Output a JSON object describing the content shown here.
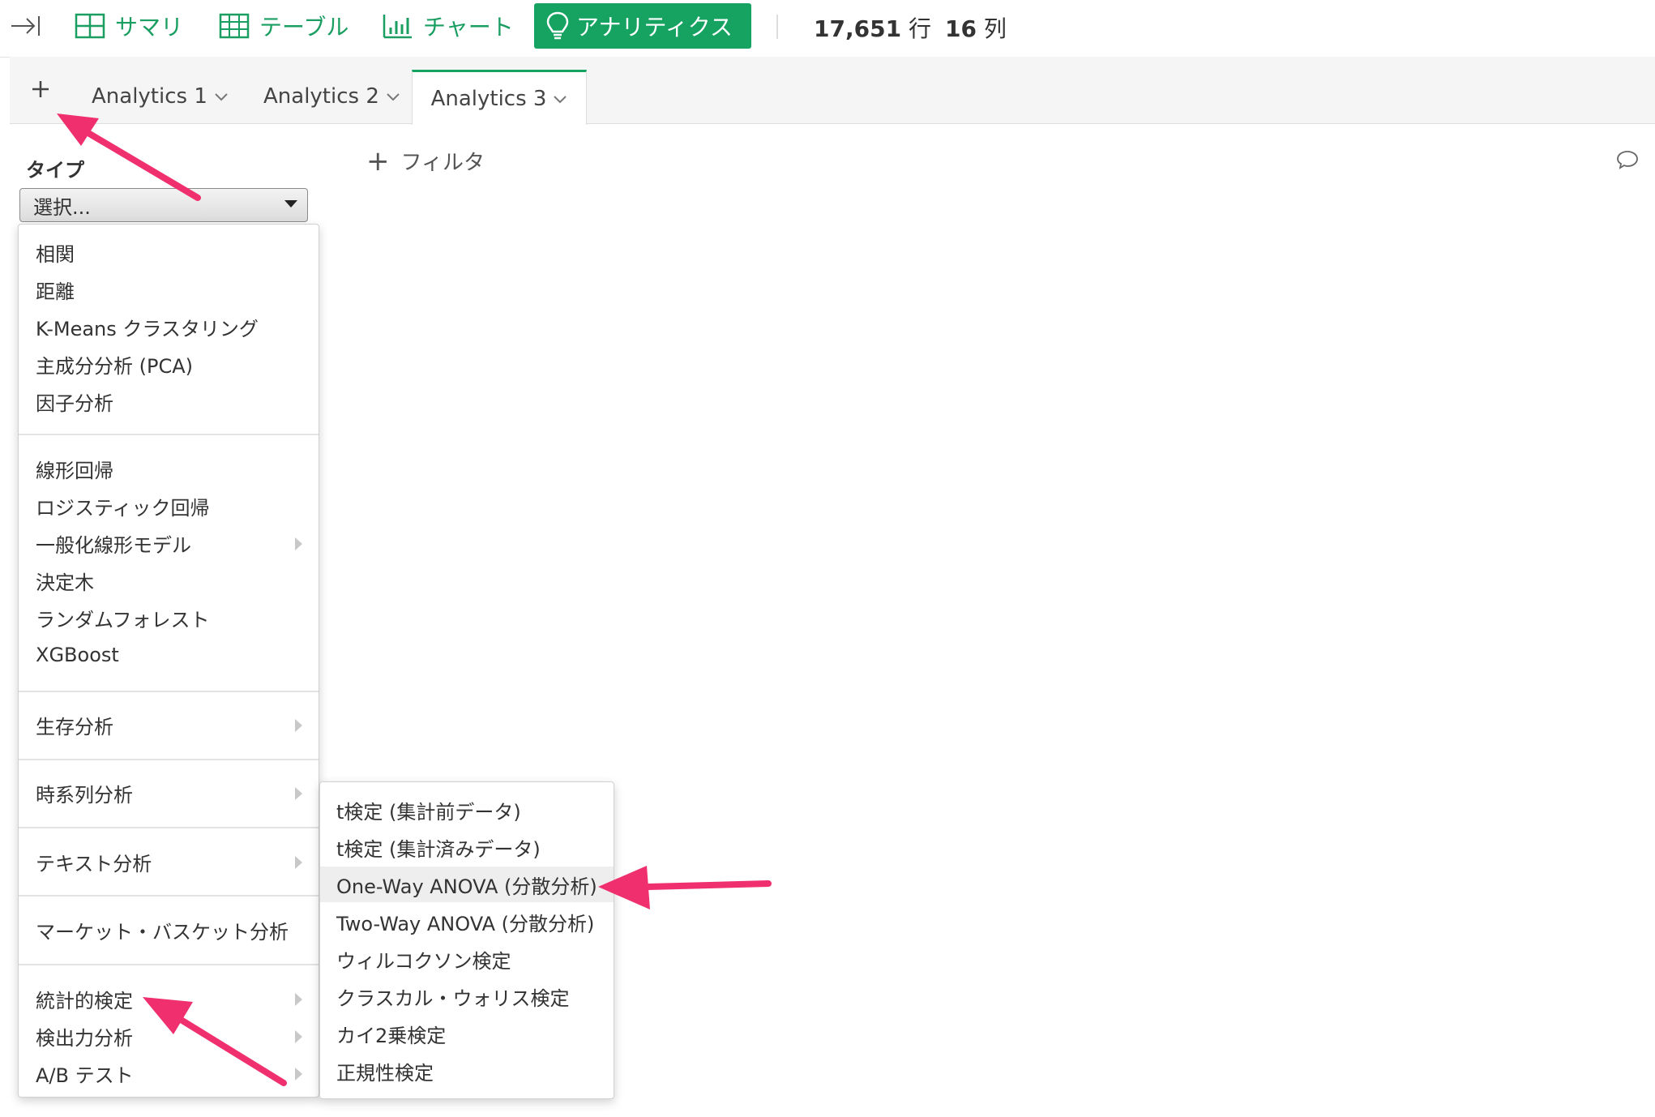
{
  "toolbar": {
    "summary_label": "サマリ",
    "table_label": "テーブル",
    "chart_label": "チャート",
    "analytics_label": "アナリティクス",
    "rows_value": "17,651",
    "rows_unit": "行",
    "cols_value": "16",
    "cols_unit": "列",
    "accent_color": "#16a362"
  },
  "tabs": [
    {
      "label": "Analytics 1"
    },
    {
      "label": "Analytics 2"
    },
    {
      "label": "Analytics 3"
    }
  ],
  "panel": {
    "type_label": "タイプ",
    "select_value": "選択...",
    "filter_label": "フィルタ"
  },
  "menu": {
    "groups": [
      [
        "相関",
        "距離",
        "K-Means クラスタリング",
        "主成分分析 (PCA)",
        "因子分析"
      ],
      [
        "線形回帰",
        "ロジスティック回帰",
        "一般化線形モデル",
        "決定木",
        "ランダムフォレスト",
        "XGBoost"
      ],
      [
        "生存分析"
      ],
      [
        "時系列分析"
      ],
      [
        "テキスト分析"
      ],
      [
        "マーケット・バスケット分析"
      ],
      [
        "統計的検定",
        "検出力分析",
        "A/B テスト"
      ]
    ]
  },
  "submenu": {
    "items": [
      "t検定 (集計前データ)",
      "t検定 (集計済みデータ)",
      "One-Way ANOVA (分散分析)",
      "Two-Way ANOVA (分散分析)",
      "ウィルコクソン検定",
      "クラスカル・ウォリス検定",
      "カイ2乗検定",
      "正規性検定"
    ],
    "highlighted_index": 2
  },
  "annotation_color": "#f0306e"
}
